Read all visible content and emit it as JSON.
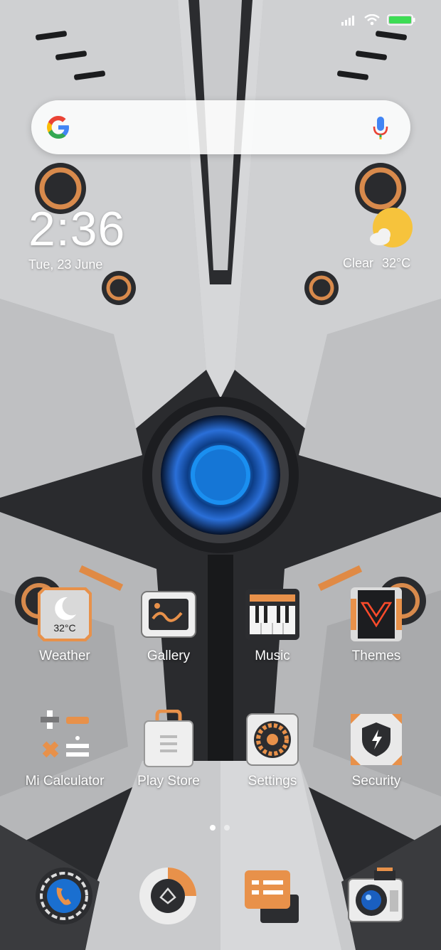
{
  "status_bar": {
    "icons": [
      "signal-icon",
      "wifi-icon",
      "battery-icon"
    ],
    "battery_color": "#3ddc54"
  },
  "search_bar": {
    "icons": [
      "google-logo-icon",
      "microphone-icon"
    ]
  },
  "clock_widget": {
    "time": "2:36",
    "date": "Tue, 23 June"
  },
  "weather_widget": {
    "condition": "Clear",
    "temperature": "32°C",
    "icon": "sun-cloud-icon"
  },
  "apps_row1": [
    {
      "label": "Weather",
      "icon": "weather-app-icon",
      "badge_text": "32°C"
    },
    {
      "label": "Gallery",
      "icon": "gallery-app-icon"
    },
    {
      "label": "Music",
      "icon": "music-app-icon"
    },
    {
      "label": "Themes",
      "icon": "themes-app-icon"
    }
  ],
  "apps_row2": [
    {
      "label": "Mi Calculator",
      "icon": "calculator-app-icon"
    },
    {
      "label": "Play Store",
      "icon": "play-store-app-icon"
    },
    {
      "label": "Settings",
      "icon": "settings-app-icon"
    },
    {
      "label": "Security",
      "icon": "security-app-icon"
    }
  ],
  "page_indicator": {
    "pages": 2,
    "current": 1
  },
  "dock": [
    {
      "icon": "phone-app-icon"
    },
    {
      "icon": "browser-app-icon"
    },
    {
      "icon": "messages-app-icon"
    },
    {
      "icon": "camera-app-icon"
    }
  ],
  "colors": {
    "accent_orange": "#e8914a",
    "core_blue": "#1a7fe0",
    "panel_gray": "#c5c6c8",
    "dark_panel": "#2c2d30"
  }
}
